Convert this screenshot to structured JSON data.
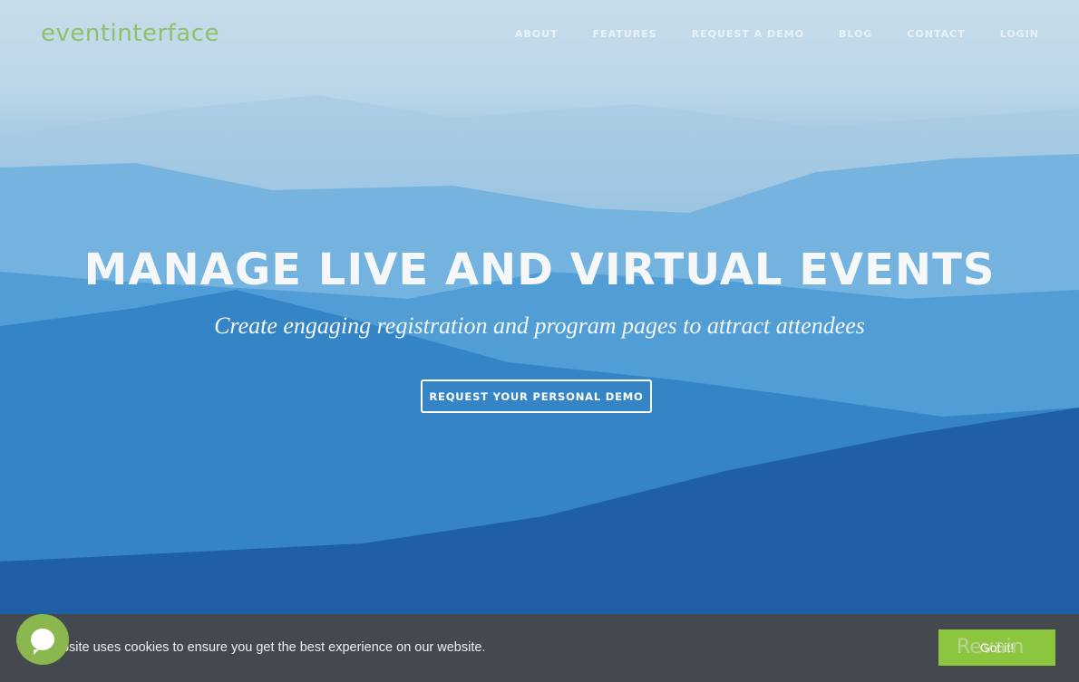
{
  "header": {
    "logo": "eventinterface",
    "nav": [
      "ABOUT",
      "FEATURES",
      "REQUEST A DEMO",
      "BLOG",
      "CONTACT",
      "LOGIN"
    ]
  },
  "hero": {
    "headline": "MANAGE LIVE AND VIRTUAL EVENTS",
    "subheadline": "Create engaging registration and program pages to attract attendees",
    "cta_label": "REQUEST YOUR PERSONAL DEMO"
  },
  "cookie_bar": {
    "message": "This website uses cookies to ensure you get the best experience on our website.",
    "accept_label": "Got it!"
  },
  "chat_widget": {
    "icon": "chat-bubble-icon"
  },
  "watermark": {
    "text": "Revain"
  },
  "colors": {
    "brand_green": "#8dc26a",
    "button_green": "#8cc63f",
    "cookie_bg": "#444950"
  }
}
